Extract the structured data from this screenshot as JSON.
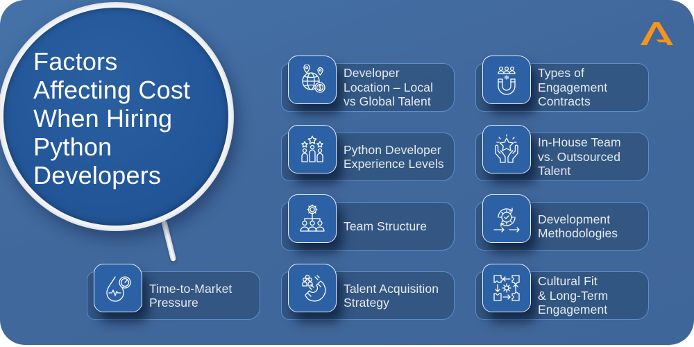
{
  "brand": {
    "logo_icon": "triangle-logo-icon",
    "accent_color": "#f7941d"
  },
  "title": {
    "lines": [
      "Factors",
      "Affecting Cost",
      "When Hiring",
      "Python",
      "Developers"
    ]
  },
  "colors": {
    "background": "#4270a4",
    "lens": "#23579a",
    "icon_box": "#2d61a6",
    "text": "#ffffff"
  },
  "factors": [
    {
      "icon": "globe-location-coin-icon",
      "lines": [
        "Developer",
        "Location – Local",
        "vs Global Talent"
      ]
    },
    {
      "icon": "magnet-people-icon",
      "lines": [
        "Types of",
        "Engagement",
        "Contracts"
      ]
    },
    {
      "icon": "ranked-people-stars-icon",
      "lines": [
        "Python Developer",
        "Experience Levels"
      ]
    },
    {
      "icon": "hands-star-icon",
      "lines": [
        "In-House Team",
        "vs. Outsourced",
        "Talent"
      ]
    },
    {
      "icon": "team-hierarchy-gear-icon",
      "lines": [
        "Team Structure"
      ]
    },
    {
      "icon": "cycle-gear-check-icon",
      "lines": [
        "Development",
        "Methodologies"
      ]
    },
    {
      "icon": "drop-gauge-icon",
      "lines": [
        "Time-to-Market",
        "Pressure"
      ]
    },
    {
      "icon": "magnet-attract-icon",
      "lines": [
        "Talent Acquisition",
        "Strategy"
      ]
    },
    {
      "icon": "puzzle-gear-cycle-icon",
      "lines": [
        "Cultural Fit",
        "& Long-Term",
        "Engagement"
      ]
    }
  ]
}
